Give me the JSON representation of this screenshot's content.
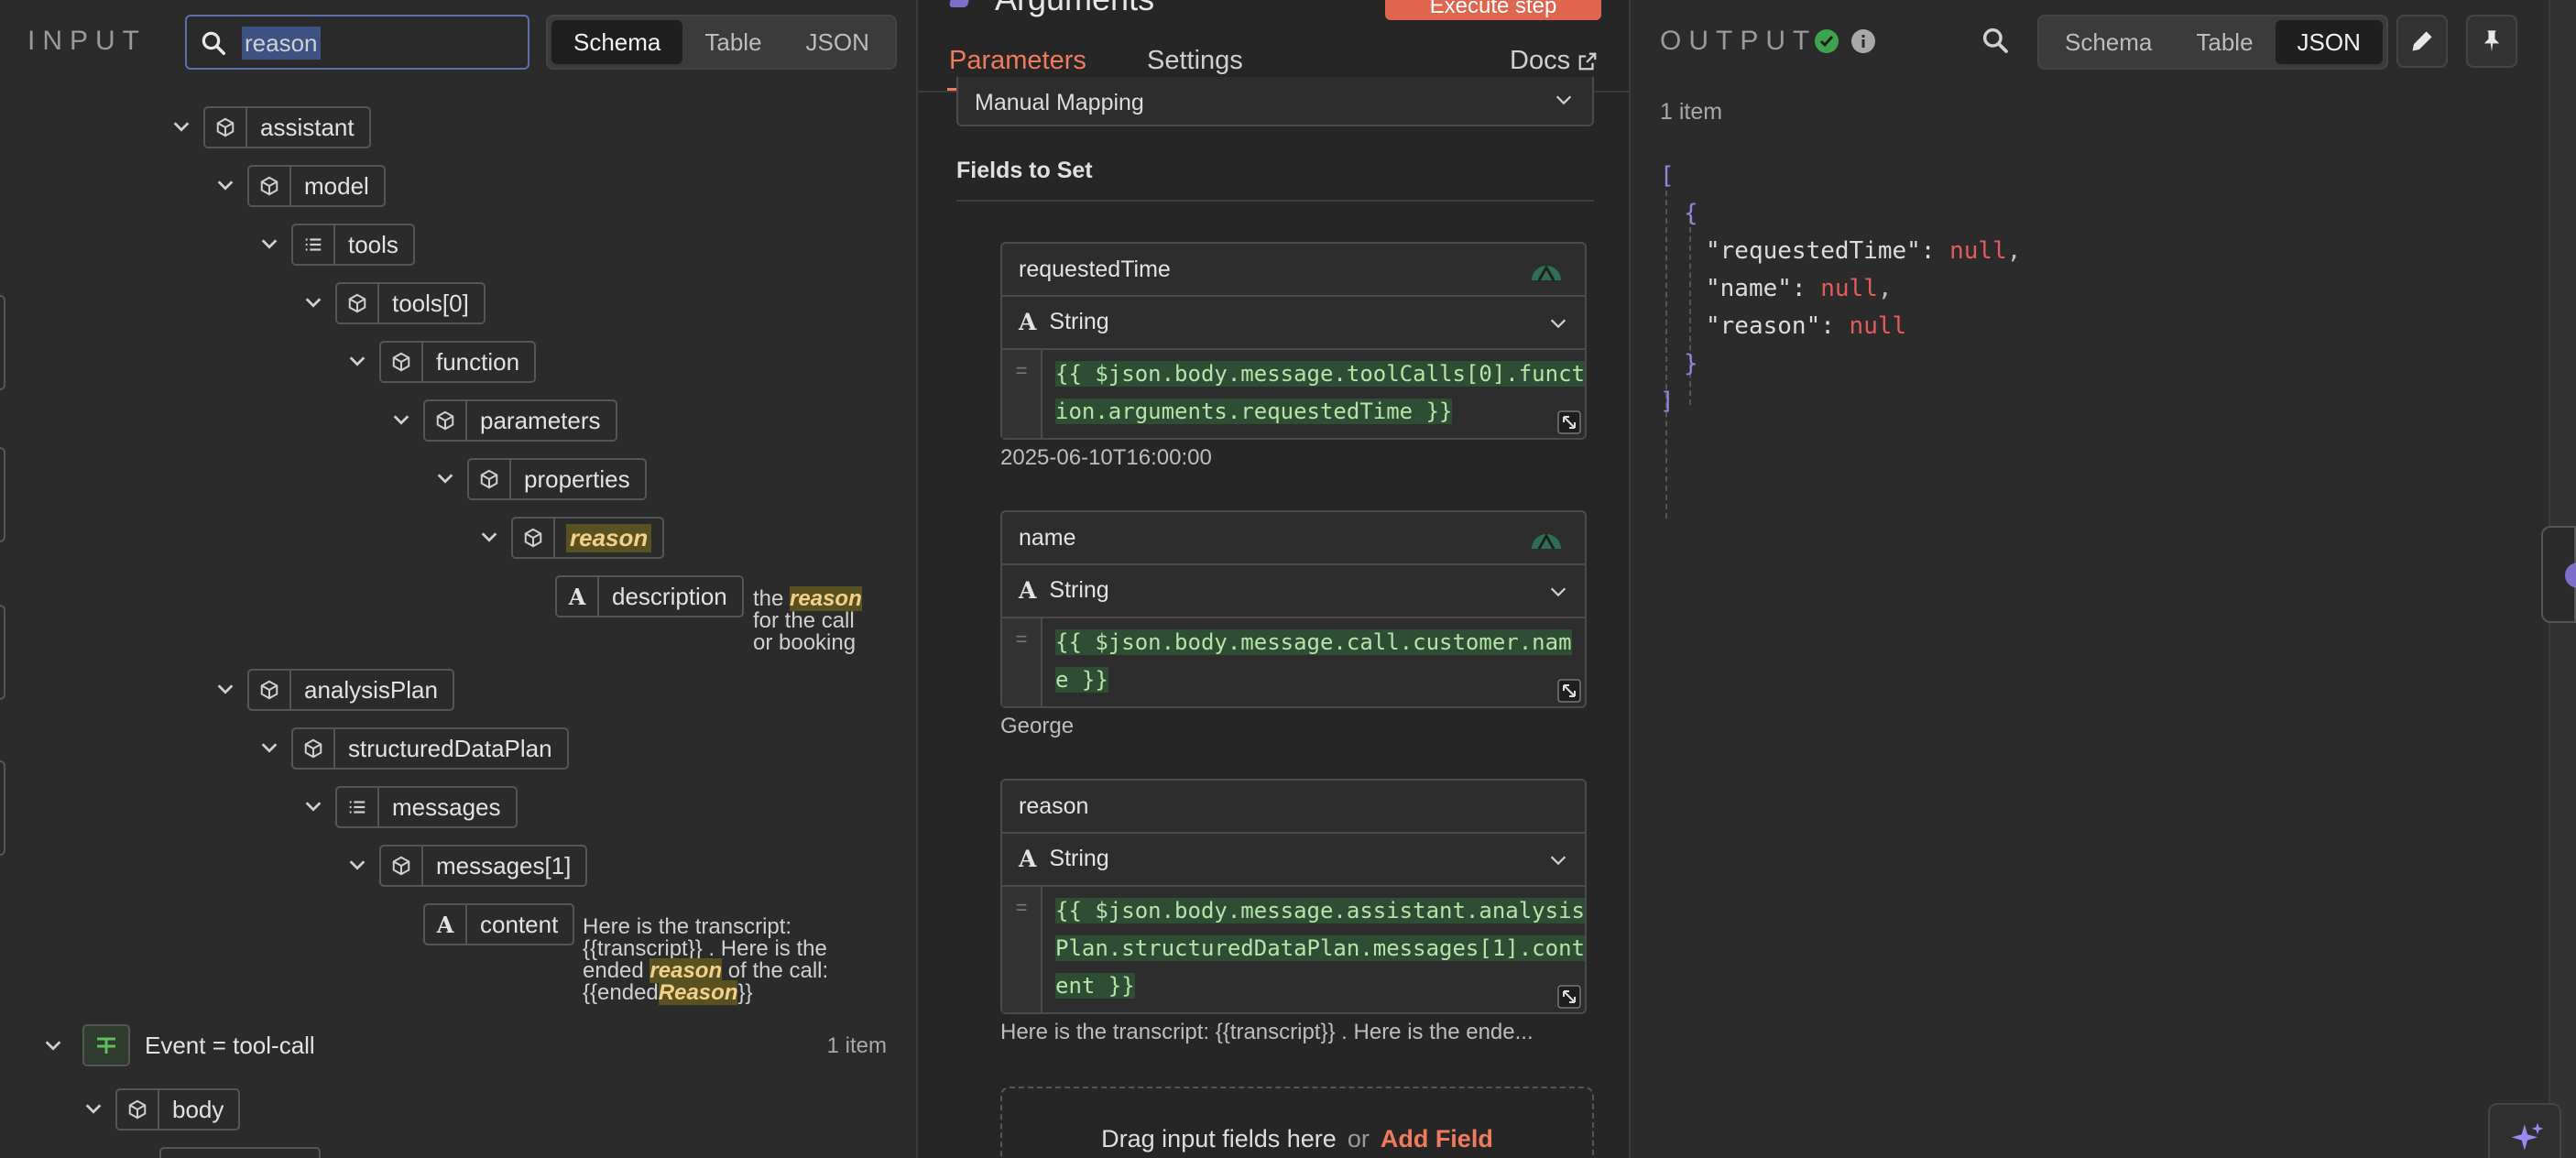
{
  "input": {
    "title": "INPUT",
    "search_value": "reason",
    "views": [
      "Schema",
      "Table",
      "JSON"
    ],
    "active_view": "Schema",
    "tree": {
      "assistant": "assistant",
      "model": "model",
      "tools": "tools",
      "tools0": "tools[0]",
      "function": "function",
      "parameters": "parameters",
      "properties": "properties",
      "reason": "reason",
      "description": "description",
      "description_value": {
        "before": "the ",
        "match": "reason",
        "after_1": "for the call",
        "after_2": "or booking"
      },
      "analysisPlan": "analysisPlan",
      "structuredDataPlan": "structuredDataPlan",
      "messages": "messages",
      "messages1": "messages[1]",
      "content": "content",
      "content_value": {
        "line1": "Here is the transcript:",
        "line2": "{{transcript}} . Here is the",
        "line3_before": "ended ",
        "line3_match": "reason",
        "line3_after": " of the call:",
        "line4_before": "{{ended",
        "line4_match": "Reason",
        "line4_after": "}}"
      },
      "event": "Event = tool-call",
      "event_count": "1 item",
      "body": "body"
    }
  },
  "params": {
    "node_title": "Arguments",
    "execute_label": "Execute step",
    "tabs": [
      "Parameters",
      "Settings"
    ],
    "active_tab": "Parameters",
    "docs_label": "Docs",
    "mode_value": "Manual Mapping",
    "fields_label": "Fields to Set",
    "fields": [
      {
        "name": "requestedTime",
        "type": "String",
        "expr_1": "{{ $json.body.message.toolCalls[0].funct",
        "expr_2": "ion.arguments.requestedTime }}",
        "expr_3": "",
        "hint": "2025-06-10T16:00:00"
      },
      {
        "name": "name",
        "type": "String",
        "expr_1": "{{ $json.body.message.call.customer.nam",
        "expr_2": "e }}",
        "expr_3": "",
        "hint": "George"
      },
      {
        "name": "reason",
        "type": "String",
        "expr_1": "{{ $json.body.message.assistant.analysis",
        "expr_2": "Plan.structuredDataPlan.messages[1].cont",
        "expr_3": "ent }}",
        "hint": "Here is the transcript: {{transcript}} . Here is the ende..."
      }
    ],
    "drop_text": "Drag input fields here",
    "drop_or": "or",
    "add_field_label": "Add Field"
  },
  "output": {
    "title": "OUTPUT",
    "views": [
      "Schema",
      "Table",
      "JSON"
    ],
    "active_view": "JSON",
    "count": "1 item",
    "json": {
      "open_array": "[",
      "open_obj": "{",
      "keys": [
        "\"requestedTime\":",
        "\"name\":",
        "\"reason\":"
      ],
      "null": "null",
      "close_obj": "}",
      "close_array": "]"
    }
  },
  "colors": {
    "accent": "#ef7a5c",
    "success": "#3fa34d",
    "json_bracket": "#8d88d8",
    "json_null": "#e35b5b",
    "expr_text": "#b5e3a8",
    "search_highlight": "#5a5120"
  }
}
